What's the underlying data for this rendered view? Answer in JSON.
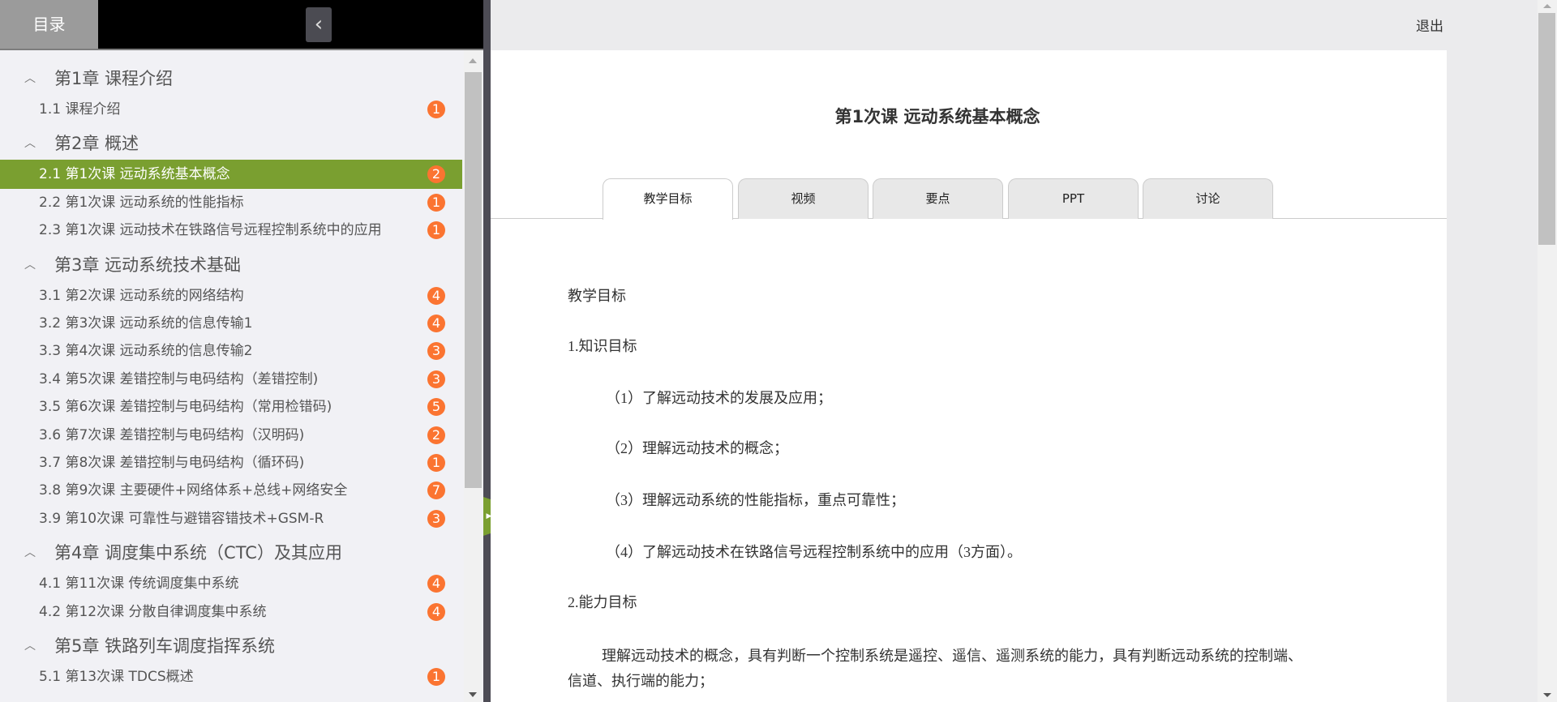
{
  "sidebar": {
    "toc_tab": "目录",
    "collapse_icon": "‹",
    "chapters": [
      {
        "title": "第1章 课程介绍",
        "items": [
          {
            "label": "1.1 课程介绍",
            "badge": "1"
          }
        ]
      },
      {
        "title": "第2章 概述",
        "items": [
          {
            "label": "2.1 第1次课 远动系统基本概念",
            "badge": "2"
          },
          {
            "label": "2.2 第1次课 远动系统的性能指标",
            "badge": "1"
          },
          {
            "label": "2.3 第1次课 远动技术在铁路信号远程控制系统中的应用",
            "badge": "1"
          }
        ]
      },
      {
        "title": "第3章 远动系统技术基础",
        "items": [
          {
            "label": "3.1 第2次课 远动系统的网络结构",
            "badge": "4"
          },
          {
            "label": "3.2 第3次课 远动系统的信息传输1",
            "badge": "4"
          },
          {
            "label": "3.3 第4次课 远动系统的信息传输2",
            "badge": "3"
          },
          {
            "label": "3.4 第5次课 差错控制与电码结构（差错控制)",
            "badge": "3"
          },
          {
            "label": "3.5 第6次课 差错控制与电码结构（常用检错码)",
            "badge": "5"
          },
          {
            "label": "3.6 第7次课 差错控制与电码结构（汉明码)",
            "badge": "2"
          },
          {
            "label": "3.7 第8次课 差错控制与电码结构（循环码)",
            "badge": "1"
          },
          {
            "label": "3.8 第9次课 主要硬件+网络体系+总线+网络安全",
            "badge": "7"
          },
          {
            "label": "3.9 第10次课 可靠性与避错容错技术+GSM-R",
            "badge": "3"
          }
        ]
      },
      {
        "title": "第4章 调度集中系统（CTC）及其应用",
        "items": [
          {
            "label": "4.1 第11次课 传统调度集中系统",
            "badge": "4"
          },
          {
            "label": "4.2 第12次课 分散自律调度集中系统",
            "badge": "4"
          }
        ]
      },
      {
        "title": "第5章 铁路列车调度指挥系统",
        "items": [
          {
            "label": "5.1 第13次课 TDCS概述",
            "badge": "1"
          }
        ]
      }
    ],
    "active_item": "2.1"
  },
  "header": {
    "exit": "退出"
  },
  "main": {
    "title": "第1次课 远动系统基本概念",
    "tabs": [
      "教学目标",
      "视频",
      "要点",
      "PPT",
      "讨论"
    ],
    "active_tab": "教学目标",
    "content": [
      "教学目标",
      "1.知识目标",
      "（1）了解远动技术的发展及应用；",
      "（2）理解远动技术的概念；",
      "（3）理解远动系统的性能指标，重点可靠性；",
      "（4）了解远动技术在铁路信号远程控制系统中的应用（3方面）。",
      "2.能力目标",
      "理解远动技术的概念，具有判断一个控制系统是遥控、遥信、遥测系统的能力，具有判断远动系统的控制端、信道、执行端的能力；"
    ]
  },
  "colors": {
    "accent": "#7a9f30",
    "badge": "#fb7431"
  }
}
